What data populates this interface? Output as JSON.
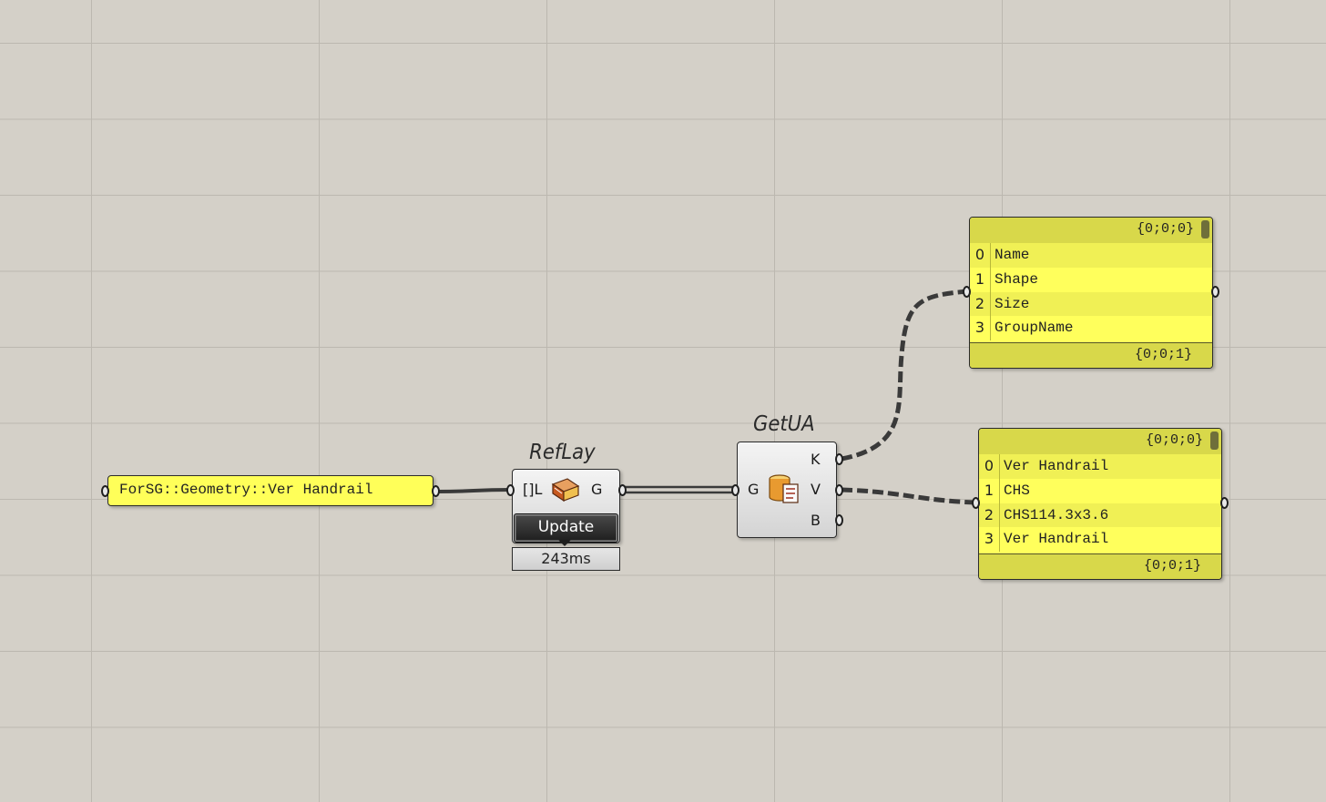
{
  "text_panel": {
    "value": "ForSG::Geometry::Ver Handrail"
  },
  "reflay": {
    "nickname": "RefLay",
    "input_label": "[]L",
    "output_label": "G",
    "button_label": "Update",
    "timing": "243ms"
  },
  "getua": {
    "nickname": "GetUA",
    "input_label": "G",
    "outputs": [
      "K",
      "V",
      "B"
    ]
  },
  "keys_panel": {
    "header_path": "{0;0;0}",
    "footer_path": "{0;0;1}",
    "rows": [
      {
        "index": "0",
        "value": "Name"
      },
      {
        "index": "1",
        "value": "Shape"
      },
      {
        "index": "2",
        "value": "Size"
      },
      {
        "index": "3",
        "value": "GroupName"
      }
    ]
  },
  "values_panel": {
    "header_path": "{0;0;0}",
    "footer_path": "{0;0;1}",
    "rows": [
      {
        "index": "0",
        "value": "Ver Handrail"
      },
      {
        "index": "1",
        "value": "CHS"
      },
      {
        "index": "2",
        "value": "CHS114.3x3.6"
      },
      {
        "index": "3",
        "value": "Ver Handrail"
      }
    ]
  },
  "colors": {
    "canvas": "#d4d0c8",
    "panel_yellow": "#ffff59",
    "panel_header": "#d8d84a",
    "wire": "#3a3a3a"
  },
  "icons": {
    "reflay_icon": "layer-reference-icon",
    "getua_icon": "user-attributes-icon"
  }
}
